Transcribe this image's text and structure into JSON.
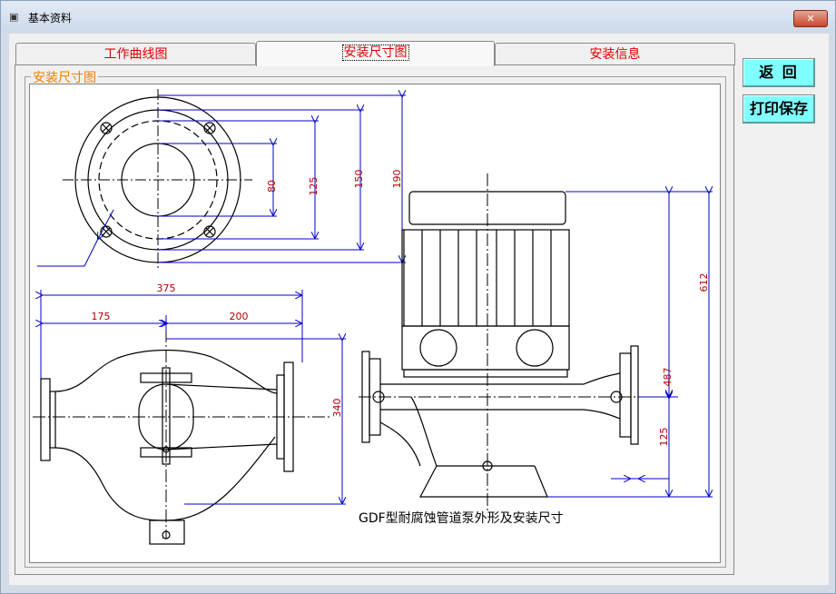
{
  "window": {
    "title": "基本资料",
    "close_glyph": "✕"
  },
  "tabs": [
    {
      "label": "工作曲线图",
      "active": false
    },
    {
      "label": "安装尺寸图",
      "active": true
    },
    {
      "label": "安装信息",
      "active": false
    }
  ],
  "group": {
    "label": "安装尺寸图"
  },
  "buttons": {
    "back": "返 回",
    "print_save": "打印保存"
  },
  "drawing": {
    "caption": "GDF型耐腐蚀管道泵外形及安装尺寸",
    "dims": {
      "d80": "80",
      "d125": "125",
      "d150": "150",
      "d190": "190",
      "d375": "375",
      "d175": "175",
      "d200": "200",
      "d340": "340",
      "d612": "612",
      "d487": "487",
      "d125b": "125"
    },
    "line_color": "#000000",
    "dim_color": "#0000c8",
    "text_color": "#b40000"
  }
}
